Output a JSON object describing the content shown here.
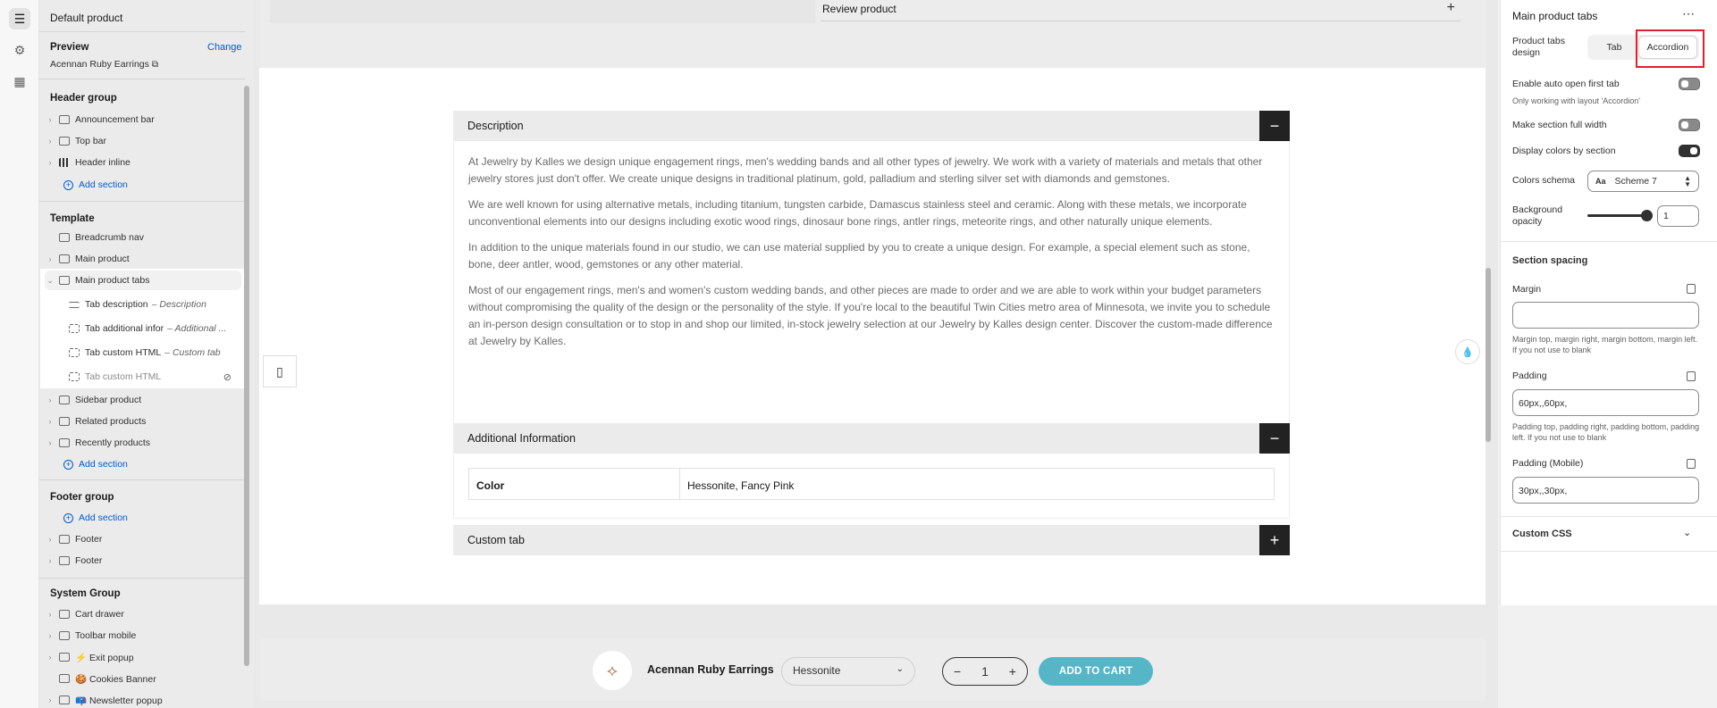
{
  "left_panel": {
    "title": "Default product",
    "preview_label": "Preview",
    "change_label": "Change",
    "preview_product": "Acennan Ruby Earrings",
    "header_group": "Header group",
    "header_items": [
      "Announcement bar",
      "Top bar",
      "Header inline"
    ],
    "add_section": "Add section",
    "template": "Template",
    "template_items": [
      "Breadcrumb nav",
      "Main product",
      "Main product tabs"
    ],
    "tabs": [
      {
        "label": "Tab description",
        "suffix": "– Description"
      },
      {
        "label": "Tab additional infor",
        "suffix": "– Additional ..."
      },
      {
        "label": "Tab custom HTML",
        "suffix": "– Custom tab"
      },
      {
        "label": "Tab custom HTML",
        "suffix": ""
      }
    ],
    "template_items_after": [
      "Sidebar product",
      "Related products",
      "Recently products"
    ],
    "footer_group": "Footer group",
    "footer_items": [
      "Footer",
      "Footer"
    ],
    "system_group": "System Group",
    "system_items": [
      "Cart drawer",
      "Toolbar mobile",
      "⚡ Exit popup",
      "🍪 Cookies Banner",
      "📪 Newsletter popup"
    ]
  },
  "canvas": {
    "review_label": "Review product",
    "review_icon": "+",
    "description_title": "Description",
    "description_paragraphs": [
      "At Jewelry by Kalles we design unique engagement rings, men's wedding bands and all other types of jewelry. We work with a variety of materials and metals that other jewelry stores just don't offer. We create unique designs in traditional platinum, gold, palladium and sterling silver set with diamonds and gemstones.",
      "We are well known for using alternative metals, including titanium, tungsten carbide, Damascus stainless steel and ceramic. Along with these metals, we incorporate unconventional elements into our designs including exotic wood rings, dinosaur bone rings, antler rings, meteorite rings, and other naturally unique elements.",
      "In addition to the unique materials found in our studio, we can use material supplied by you to create a unique design. For example, a special element such as stone, bone, deer antler, wood, gemstones or any other material.",
      "Most of our engagement rings, men's and women's custom wedding bands, and other pieces are made to order and we are able to work within your budget parameters without compromising the quality of the design or the personality of the style. If you're local to the beautiful Twin Cities metro area of Minnesota, we invite you to schedule an in-person design consultation or to stop in and shop our limited, in-stock jewelry selection at our Jewelry by Kalles design center. Discover the custom-made difference at Jewelry by Kalles."
    ],
    "additional_title": "Additional Information",
    "table_key": "Color",
    "table_value": "Hessonite, Fancy Pink",
    "custom_title": "Custom tab",
    "minus": "−",
    "plus": "+",
    "sticky": {
      "product_name": "Acennan Ruby Earrings",
      "variant": "Hessonite",
      "qty_minus": "−",
      "qty_value": "1",
      "qty_plus": "+",
      "add_to_cart": "ADD TO CART"
    }
  },
  "right_panel": {
    "title": "Main product tabs",
    "dots": "⋯",
    "design_label": "Product tabs design",
    "design_options": [
      "Tab",
      "Accordion"
    ],
    "selected_design": "Accordion",
    "auto_open_label": "Enable auto open first tab",
    "auto_open_help": "Only working with layout 'Accordion'",
    "auto_open": false,
    "full_width_label": "Make section full width",
    "full_width": false,
    "display_colors_label": "Display colors by section",
    "display_colors": true,
    "colors_schema_label": "Colors schema",
    "colors_schema_icon": "Aa",
    "colors_schema_value": "Scheme 7",
    "bg_opacity_label": "Background opacity",
    "bg_opacity_value": "1",
    "section_spacing": "Section spacing",
    "margin_label": "Margin",
    "margin_value": "",
    "margin_help": "Margin top, margin right, margin bottom, margin left. If you not use to blank",
    "padding_label": "Padding",
    "padding_value": "60px,,60px,",
    "padding_help": "Padding top, padding right, padding bottom, padding left. If you not use to blank",
    "padding_mobile_label": "Padding (Mobile)",
    "padding_mobile_value": "30px,,30px,",
    "custom_css": "Custom CSS"
  },
  "colors": {
    "accent_link": "#005bd3",
    "add_to_cart": "#56b6c8",
    "highlight_box": "#e0202e",
    "accordion_button": "#222222"
  }
}
